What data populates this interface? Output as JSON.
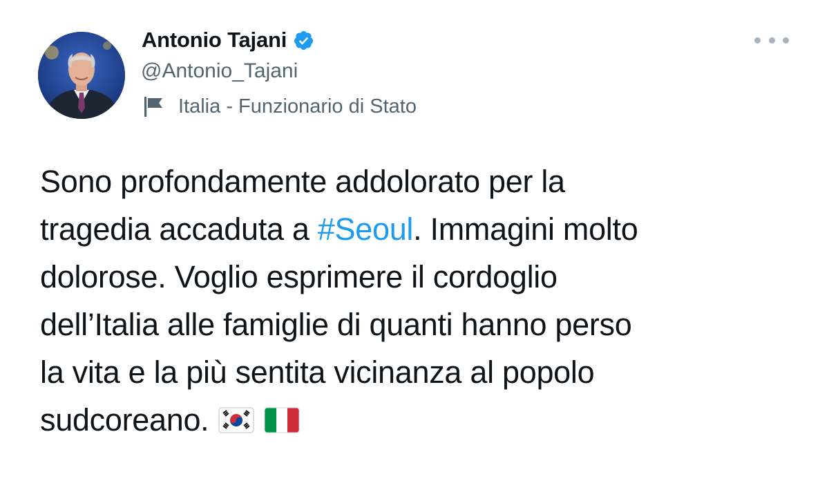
{
  "author": {
    "display_name": "Antonio Tajani",
    "handle": "@Antonio_Tajani",
    "verified": true,
    "verified_color": "#1d9bf0",
    "avatar_icon": "user-avatar-photo"
  },
  "account_label": {
    "icon": "flag-icon",
    "text": "Italia - Funzionario di Stato"
  },
  "more_icon": "more-horizontal-icon",
  "tweet": {
    "line1": "Sono profondamente addolorato per la",
    "line2_pre": "tragedia accaduta a ",
    "hashtag": "#Seoul",
    "line2_post": ". Immagini molto",
    "line3": "dolorose. Voglio esprimere il cordoglio",
    "line4": "dell’Italia alle famiglie di quanti hanno perso",
    "line5": "la vita e la più sentita vicinanza al popolo",
    "line6": "sudcoreano.",
    "emojis": [
      "south-korea-flag-emoji",
      "italy-flag-emoji"
    ]
  },
  "colors": {
    "text": "#0f1419",
    "secondary": "#536471",
    "link": "#1d9bf0"
  }
}
